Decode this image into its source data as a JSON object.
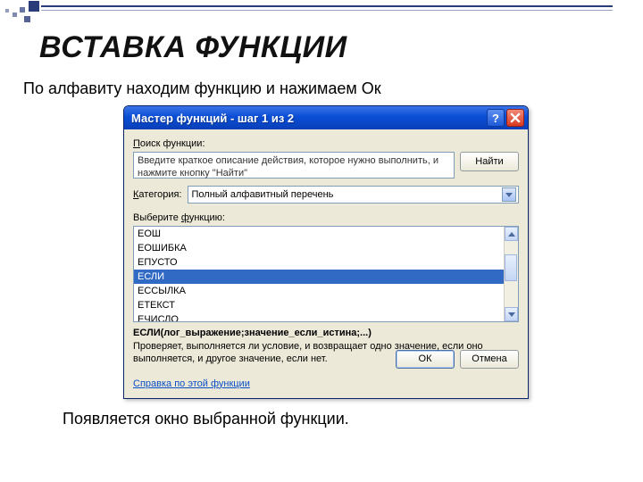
{
  "slide": {
    "title": "ВСТАВКА ФУНКЦИИ",
    "intro": "По алфавиту находим функцию и нажимаем Ок",
    "outro": "Появляется окно выбранной функции."
  },
  "dialog": {
    "title": "Мастер функций - шаг 1 из 2",
    "search_label_pre": "П",
    "search_label_post": "оиск функции:",
    "search_text": "Введите краткое описание действия, которое нужно выполнить, и нажмите кнопку \"Найти\"",
    "find_u": "Н",
    "find_post": "айти",
    "cat_label_pre": "К",
    "cat_label_post": "атегория:",
    "cat_value": "Полный алфавитный перечень",
    "func_label_pre": "Выберите ",
    "func_label_u": "ф",
    "func_label_post": "ункцию:",
    "items": {
      "0": "ЕОШ",
      "1": "ЕОШИБКА",
      "2": "ЕПУСТО",
      "3": "ЕСЛИ",
      "4": "ЕССЫЛКА",
      "5": "ЕТЕКСТ",
      "6": "ЕЧИСЛО"
    },
    "signature": "ЕСЛИ(лог_выражение;значение_если_истина;...)",
    "description": "Проверяет, выполняется ли условие, и возвращает одно значение, если оно выполняется, и другое значение, если нет.",
    "help": "Справка по этой функции",
    "ok": "ОК",
    "cancel": "Отмена",
    "help_symbol": "?"
  }
}
